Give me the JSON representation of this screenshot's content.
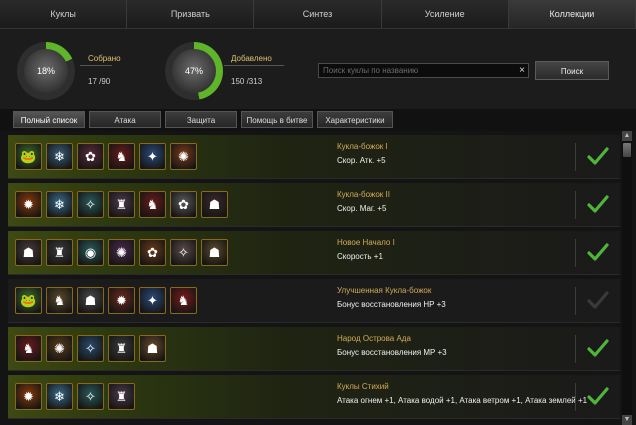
{
  "tabs": [
    "Куклы",
    "Призвать",
    "Синтез",
    "Усиление",
    "Коллекции"
  ],
  "active_tab": 4,
  "stats": {
    "collected": {
      "percent_label": "18%",
      "percent": 18,
      "label": "Собрано",
      "value": "17 /90"
    },
    "added": {
      "percent_label": "47%",
      "percent": 47,
      "label": "Добавлено",
      "value": "150 /313"
    }
  },
  "search": {
    "placeholder": "Поиск куклы по названию",
    "clear_icon": "×",
    "button": "Поиск"
  },
  "filters": [
    "Полный список",
    "Атака",
    "Защита",
    "Помощь в битве",
    "Характеристики"
  ],
  "active_filter": 0,
  "colors": {
    "accent": "#5fb52a",
    "name": "#d4aa5a",
    "check": "#4fb43a",
    "check_off": "#3a3a3a"
  },
  "collections": [
    {
      "name": "Кукла-божок I",
      "bonus": "Скор. Атк. +5",
      "complete": true,
      "dolls": [
        {
          "icon": "frog-doll-icon",
          "glyph": "🐸",
          "color": "#3d6b2a"
        },
        {
          "icon": "ice-mage-doll-icon",
          "glyph": "❄",
          "color": "#3a5c7a"
        },
        {
          "icon": "dark-girl-doll-icon",
          "glyph": "✿",
          "color": "#5a2a3a"
        },
        {
          "icon": "red-warrior-doll-icon",
          "glyph": "♞",
          "color": "#6a1a1a"
        },
        {
          "icon": "crystal-doll-icon",
          "glyph": "✦",
          "color": "#2a4a7a"
        },
        {
          "icon": "fire-girl-doll-icon",
          "glyph": "✺",
          "color": "#7a3a1a"
        }
      ]
    },
    {
      "name": "Кукла-божок II",
      "bonus": "Скор. Маг. +5",
      "complete": true,
      "dolls": [
        {
          "icon": "flame-doll-icon",
          "glyph": "✹",
          "color": "#8a3a0a"
        },
        {
          "icon": "frost-doll-icon",
          "glyph": "❄",
          "color": "#3a6a8a"
        },
        {
          "icon": "teal-mage-doll-icon",
          "glyph": "✧",
          "color": "#2a5a5a"
        },
        {
          "icon": "armored-doll-icon",
          "glyph": "♜",
          "color": "#4a3a4a"
        },
        {
          "icon": "demon-doll-icon",
          "glyph": "♞",
          "color": "#6a1a1a"
        },
        {
          "icon": "white-hair-doll-icon",
          "glyph": "✿",
          "color": "#5a5a5a"
        },
        {
          "icon": "shadow-doll-icon",
          "glyph": "☗",
          "color": "#3a2a2a"
        }
      ]
    },
    {
      "name": "Новое Начало I",
      "bonus": "Скорость +1",
      "complete": true,
      "dolls": [
        {
          "icon": "hooded-doll-icon",
          "glyph": "☗",
          "color": "#4a3a3a"
        },
        {
          "icon": "knight-doll-icon",
          "glyph": "♜",
          "color": "#3a3a3a"
        },
        {
          "icon": "orb-doll-icon",
          "glyph": "◉",
          "color": "#2a5a5a"
        },
        {
          "icon": "witch-doll-icon",
          "glyph": "✺",
          "color": "#4a2a4a"
        },
        {
          "icon": "goblin-doll-icon",
          "glyph": "✿",
          "color": "#6a3a1a"
        },
        {
          "icon": "pale-doll-icon",
          "glyph": "✧",
          "color": "#5a4a4a"
        },
        {
          "icon": "stone-doll-icon",
          "glyph": "☗",
          "color": "#5a4a2a"
        }
      ]
    },
    {
      "name": "Улучшенная Кукла-божок",
      "bonus": "Бонус восстановления HP +3",
      "complete": false,
      "dolls": [
        {
          "icon": "frog-doll-icon",
          "glyph": "🐸",
          "color": "#3d6b2a"
        },
        {
          "icon": "brute-doll-icon",
          "glyph": "♞",
          "color": "#5a4a2a"
        },
        {
          "icon": "grey-ghost-doll-icon",
          "glyph": "☗",
          "color": "#4a4a4a"
        },
        {
          "icon": "fire-warrior-doll-icon",
          "glyph": "✹",
          "color": "#6a2a1a"
        },
        {
          "icon": "crystal-doll-icon",
          "glyph": "✦",
          "color": "#2a4a7a"
        },
        {
          "icon": "red-demon-doll-icon",
          "glyph": "♞",
          "color": "#7a1a1a"
        }
      ]
    },
    {
      "name": "Народ Острова Ада",
      "bonus": "Бонус восстановления MP +3",
      "complete": true,
      "dolls": [
        {
          "icon": "red-warrior-doll-icon",
          "glyph": "♞",
          "color": "#6a1a1a"
        },
        {
          "icon": "orc-doll-icon",
          "glyph": "✺",
          "color": "#5a3a1a"
        },
        {
          "icon": "blue-mage-doll-icon",
          "glyph": "✧",
          "color": "#2a4a6a"
        },
        {
          "icon": "dark-knight-doll-icon",
          "glyph": "♜",
          "color": "#3a3a3a"
        },
        {
          "icon": "golem-doll-icon",
          "glyph": "☗",
          "color": "#6a4a2a"
        }
      ]
    },
    {
      "name": "Куклы Стихий",
      "bonus": "Атака огнем +1, Атака водой +1, Атака ветром +1, Атака землей +1",
      "complete": true,
      "dolls": [
        {
          "icon": "flame-doll-icon",
          "glyph": "✹",
          "color": "#8a3a0a"
        },
        {
          "icon": "frost-doll-icon",
          "glyph": "❄",
          "color": "#3a6a8a"
        },
        {
          "icon": "teal-mage-doll-icon",
          "glyph": "✧",
          "color": "#2a5a5a"
        },
        {
          "icon": "armored-doll-icon",
          "glyph": "♜",
          "color": "#4a3a4a"
        }
      ]
    }
  ]
}
